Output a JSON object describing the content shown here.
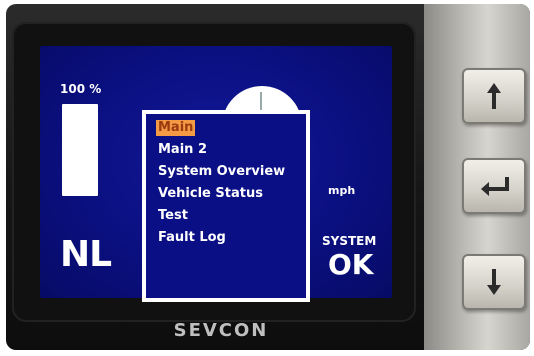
{
  "display": {
    "battery": {
      "label": "100 %",
      "level": 1.0
    },
    "gear": "NL",
    "speed_unit": "mph",
    "system": {
      "label": "SYSTEM",
      "status": "OK"
    }
  },
  "menu": {
    "items": [
      {
        "label": "Main",
        "selected": true
      },
      {
        "label": "Main 2",
        "selected": false
      },
      {
        "label": "System Overview",
        "selected": false
      },
      {
        "label": "Vehicle Status",
        "selected": false
      },
      {
        "label": "Test",
        "selected": false
      },
      {
        "label": "Fault Log",
        "selected": false
      }
    ]
  },
  "device": {
    "brand": "SEVCON"
  },
  "buttons": [
    {
      "name": "up-button",
      "icon": "arrow-up-icon"
    },
    {
      "name": "enter-button",
      "icon": "enter-return-icon"
    },
    {
      "name": "down-button",
      "icon": "arrow-down-icon"
    }
  ],
  "colors": {
    "screen_bg": "#0a0f7e",
    "selection_bg": "#f39a45",
    "text": "#ffffff"
  }
}
